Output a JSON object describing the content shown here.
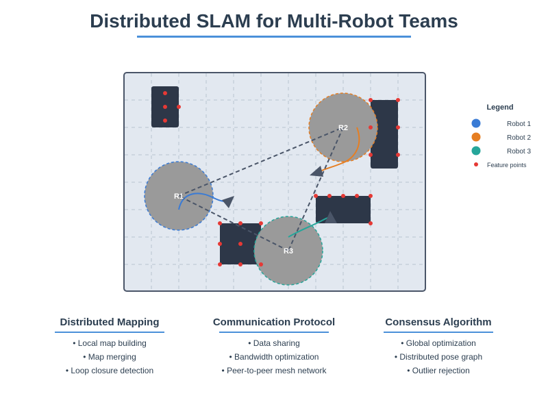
{
  "title": "Distributed SLAM for Multi-Robot Teams",
  "colors": {
    "accent": "#4a90d9",
    "robot1": "#3a7bd5",
    "robot2": "#e67e22",
    "robot3": "#26a69a",
    "feature": "#e53935",
    "obstacle": "#2d3748",
    "map_bg": "#e2e8f0",
    "map_border": "#4a5568",
    "robot_disc": "#9a9a9a",
    "dashed_link": "#4a5568"
  },
  "legend": {
    "title": "Legend",
    "items": [
      {
        "label": "Robot 1",
        "icon": "robot1-dot-icon"
      },
      {
        "label": "Robot 2",
        "icon": "robot2-dot-icon"
      },
      {
        "label": "Robot 3",
        "icon": "robot3-dot-icon"
      },
      {
        "label": "Feature points",
        "icon": "feature-point-icon"
      }
    ]
  },
  "robots": [
    {
      "label": "R1"
    },
    {
      "label": "R2"
    },
    {
      "label": "R3"
    }
  ],
  "sections": [
    {
      "title": "Distributed Mapping",
      "items": [
        "• Local map building",
        "• Map merging",
        "• Loop closure detection"
      ]
    },
    {
      "title": "Communication Protocol",
      "items": [
        "• Data sharing",
        "• Bandwidth optimization",
        "• Peer-to-peer mesh network"
      ]
    },
    {
      "title": "Consensus Algorithm",
      "items": [
        "• Global optimization",
        "• Distributed pose graph",
        "• Outlier rejection"
      ]
    }
  ]
}
